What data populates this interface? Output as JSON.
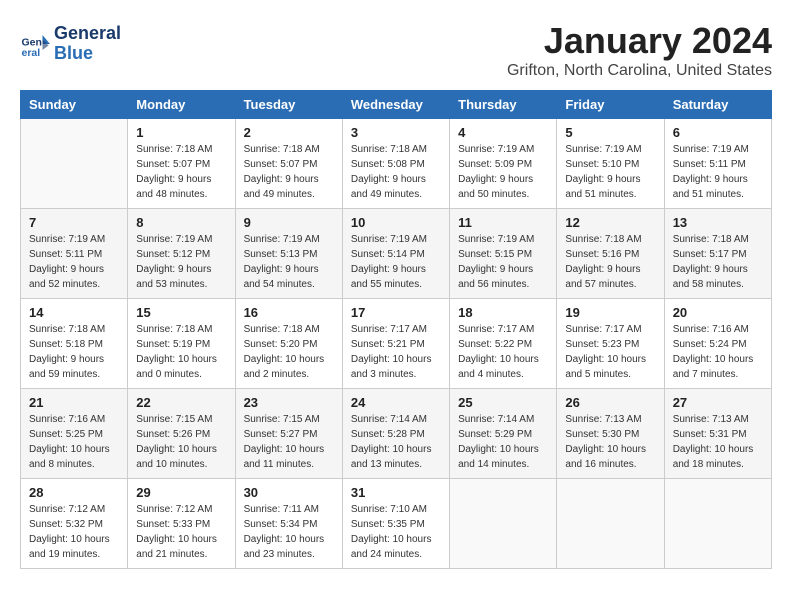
{
  "logo": {
    "general": "General",
    "blue": "Blue"
  },
  "header": {
    "title": "January 2024",
    "location": "Grifton, North Carolina, United States"
  },
  "calendar": {
    "days_of_week": [
      "Sunday",
      "Monday",
      "Tuesday",
      "Wednesday",
      "Thursday",
      "Friday",
      "Saturday"
    ],
    "weeks": [
      [
        {
          "day": "",
          "sunrise": "",
          "sunset": "",
          "daylight": ""
        },
        {
          "day": "1",
          "sunrise": "Sunrise: 7:18 AM",
          "sunset": "Sunset: 5:07 PM",
          "daylight": "Daylight: 9 hours and 48 minutes."
        },
        {
          "day": "2",
          "sunrise": "Sunrise: 7:18 AM",
          "sunset": "Sunset: 5:07 PM",
          "daylight": "Daylight: 9 hours and 49 minutes."
        },
        {
          "day": "3",
          "sunrise": "Sunrise: 7:18 AM",
          "sunset": "Sunset: 5:08 PM",
          "daylight": "Daylight: 9 hours and 49 minutes."
        },
        {
          "day": "4",
          "sunrise": "Sunrise: 7:19 AM",
          "sunset": "Sunset: 5:09 PM",
          "daylight": "Daylight: 9 hours and 50 minutes."
        },
        {
          "day": "5",
          "sunrise": "Sunrise: 7:19 AM",
          "sunset": "Sunset: 5:10 PM",
          "daylight": "Daylight: 9 hours and 51 minutes."
        },
        {
          "day": "6",
          "sunrise": "Sunrise: 7:19 AM",
          "sunset": "Sunset: 5:11 PM",
          "daylight": "Daylight: 9 hours and 51 minutes."
        }
      ],
      [
        {
          "day": "7",
          "sunrise": "Sunrise: 7:19 AM",
          "sunset": "Sunset: 5:11 PM",
          "daylight": "Daylight: 9 hours and 52 minutes."
        },
        {
          "day": "8",
          "sunrise": "Sunrise: 7:19 AM",
          "sunset": "Sunset: 5:12 PM",
          "daylight": "Daylight: 9 hours and 53 minutes."
        },
        {
          "day": "9",
          "sunrise": "Sunrise: 7:19 AM",
          "sunset": "Sunset: 5:13 PM",
          "daylight": "Daylight: 9 hours and 54 minutes."
        },
        {
          "day": "10",
          "sunrise": "Sunrise: 7:19 AM",
          "sunset": "Sunset: 5:14 PM",
          "daylight": "Daylight: 9 hours and 55 minutes."
        },
        {
          "day": "11",
          "sunrise": "Sunrise: 7:19 AM",
          "sunset": "Sunset: 5:15 PM",
          "daylight": "Daylight: 9 hours and 56 minutes."
        },
        {
          "day": "12",
          "sunrise": "Sunrise: 7:18 AM",
          "sunset": "Sunset: 5:16 PM",
          "daylight": "Daylight: 9 hours and 57 minutes."
        },
        {
          "day": "13",
          "sunrise": "Sunrise: 7:18 AM",
          "sunset": "Sunset: 5:17 PM",
          "daylight": "Daylight: 9 hours and 58 minutes."
        }
      ],
      [
        {
          "day": "14",
          "sunrise": "Sunrise: 7:18 AM",
          "sunset": "Sunset: 5:18 PM",
          "daylight": "Daylight: 9 hours and 59 minutes."
        },
        {
          "day": "15",
          "sunrise": "Sunrise: 7:18 AM",
          "sunset": "Sunset: 5:19 PM",
          "daylight": "Daylight: 10 hours and 0 minutes."
        },
        {
          "day": "16",
          "sunrise": "Sunrise: 7:18 AM",
          "sunset": "Sunset: 5:20 PM",
          "daylight": "Daylight: 10 hours and 2 minutes."
        },
        {
          "day": "17",
          "sunrise": "Sunrise: 7:17 AM",
          "sunset": "Sunset: 5:21 PM",
          "daylight": "Daylight: 10 hours and 3 minutes."
        },
        {
          "day": "18",
          "sunrise": "Sunrise: 7:17 AM",
          "sunset": "Sunset: 5:22 PM",
          "daylight": "Daylight: 10 hours and 4 minutes."
        },
        {
          "day": "19",
          "sunrise": "Sunrise: 7:17 AM",
          "sunset": "Sunset: 5:23 PM",
          "daylight": "Daylight: 10 hours and 5 minutes."
        },
        {
          "day": "20",
          "sunrise": "Sunrise: 7:16 AM",
          "sunset": "Sunset: 5:24 PM",
          "daylight": "Daylight: 10 hours and 7 minutes."
        }
      ],
      [
        {
          "day": "21",
          "sunrise": "Sunrise: 7:16 AM",
          "sunset": "Sunset: 5:25 PM",
          "daylight": "Daylight: 10 hours and 8 minutes."
        },
        {
          "day": "22",
          "sunrise": "Sunrise: 7:15 AM",
          "sunset": "Sunset: 5:26 PM",
          "daylight": "Daylight: 10 hours and 10 minutes."
        },
        {
          "day": "23",
          "sunrise": "Sunrise: 7:15 AM",
          "sunset": "Sunset: 5:27 PM",
          "daylight": "Daylight: 10 hours and 11 minutes."
        },
        {
          "day": "24",
          "sunrise": "Sunrise: 7:14 AM",
          "sunset": "Sunset: 5:28 PM",
          "daylight": "Daylight: 10 hours and 13 minutes."
        },
        {
          "day": "25",
          "sunrise": "Sunrise: 7:14 AM",
          "sunset": "Sunset: 5:29 PM",
          "daylight": "Daylight: 10 hours and 14 minutes."
        },
        {
          "day": "26",
          "sunrise": "Sunrise: 7:13 AM",
          "sunset": "Sunset: 5:30 PM",
          "daylight": "Daylight: 10 hours and 16 minutes."
        },
        {
          "day": "27",
          "sunrise": "Sunrise: 7:13 AM",
          "sunset": "Sunset: 5:31 PM",
          "daylight": "Daylight: 10 hours and 18 minutes."
        }
      ],
      [
        {
          "day": "28",
          "sunrise": "Sunrise: 7:12 AM",
          "sunset": "Sunset: 5:32 PM",
          "daylight": "Daylight: 10 hours and 19 minutes."
        },
        {
          "day": "29",
          "sunrise": "Sunrise: 7:12 AM",
          "sunset": "Sunset: 5:33 PM",
          "daylight": "Daylight: 10 hours and 21 minutes."
        },
        {
          "day": "30",
          "sunrise": "Sunrise: 7:11 AM",
          "sunset": "Sunset: 5:34 PM",
          "daylight": "Daylight: 10 hours and 23 minutes."
        },
        {
          "day": "31",
          "sunrise": "Sunrise: 7:10 AM",
          "sunset": "Sunset: 5:35 PM",
          "daylight": "Daylight: 10 hours and 24 minutes."
        },
        {
          "day": "",
          "sunrise": "",
          "sunset": "",
          "daylight": ""
        },
        {
          "day": "",
          "sunrise": "",
          "sunset": "",
          "daylight": ""
        },
        {
          "day": "",
          "sunrise": "",
          "sunset": "",
          "daylight": ""
        }
      ]
    ]
  }
}
